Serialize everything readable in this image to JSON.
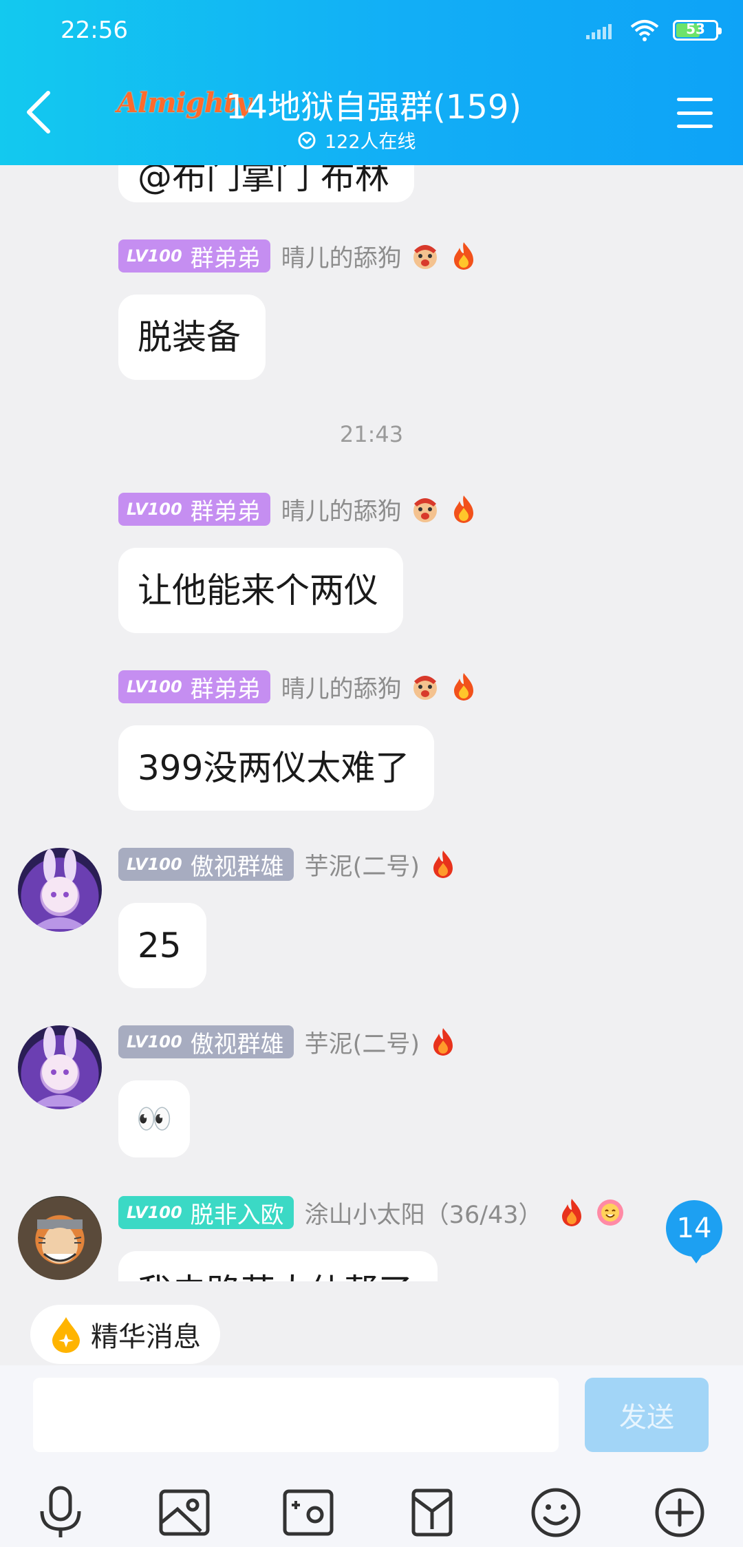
{
  "status_bar": {
    "time": "22:56",
    "battery": "53"
  },
  "header": {
    "logo_text": "Almighty",
    "title": "14地狱自强群(159)",
    "online": "122人在线"
  },
  "chat": {
    "partial_top_text": "@布门掌门 布林",
    "time_divider": "21:43",
    "messages": [
      {
        "badge_lv": "LV100",
        "badge_title": "群弟弟",
        "nick": "晴儿的舔狗",
        "text": "脱装备"
      },
      {
        "badge_lv": "LV100",
        "badge_title": "群弟弟",
        "nick": "晴儿的舔狗",
        "text": "让他能来个两仪"
      },
      {
        "badge_lv": "LV100",
        "badge_title": "群弟弟",
        "nick": "晴儿的舔狗",
        "text": "399没两仪太难了"
      },
      {
        "badge_lv": "LV100",
        "badge_title": "傲视群雄",
        "nick": "芋泥(二号)",
        "text": "25"
      },
      {
        "badge_lv": "LV100",
        "badge_title": "傲视群雄",
        "nick": "芋泥(二号)",
        "text": "👀"
      },
      {
        "badge_lv": "LV100",
        "badge_title": "脱非入欧",
        "nick": "涂山小太阳（36/43）",
        "text": "我去路营太仙帮了"
      }
    ],
    "unread_count": "14"
  },
  "input": {
    "essence_label": "精华消息",
    "placeholder": "",
    "send_label": "发送"
  },
  "toolbar": [
    "mic-icon",
    "image-icon",
    "camera-icon",
    "red-packet-icon",
    "emoji-icon",
    "plus-icon"
  ],
  "colors": {
    "header_start": "#13c9ef",
    "header_end": "#0ea3f7",
    "badge_purple": "#c58ef1",
    "badge_gray": "#a7acc0",
    "badge_teal": "#3bd9c5",
    "send_disabled": "#a2d5f7",
    "unread": "#1da0f2"
  }
}
